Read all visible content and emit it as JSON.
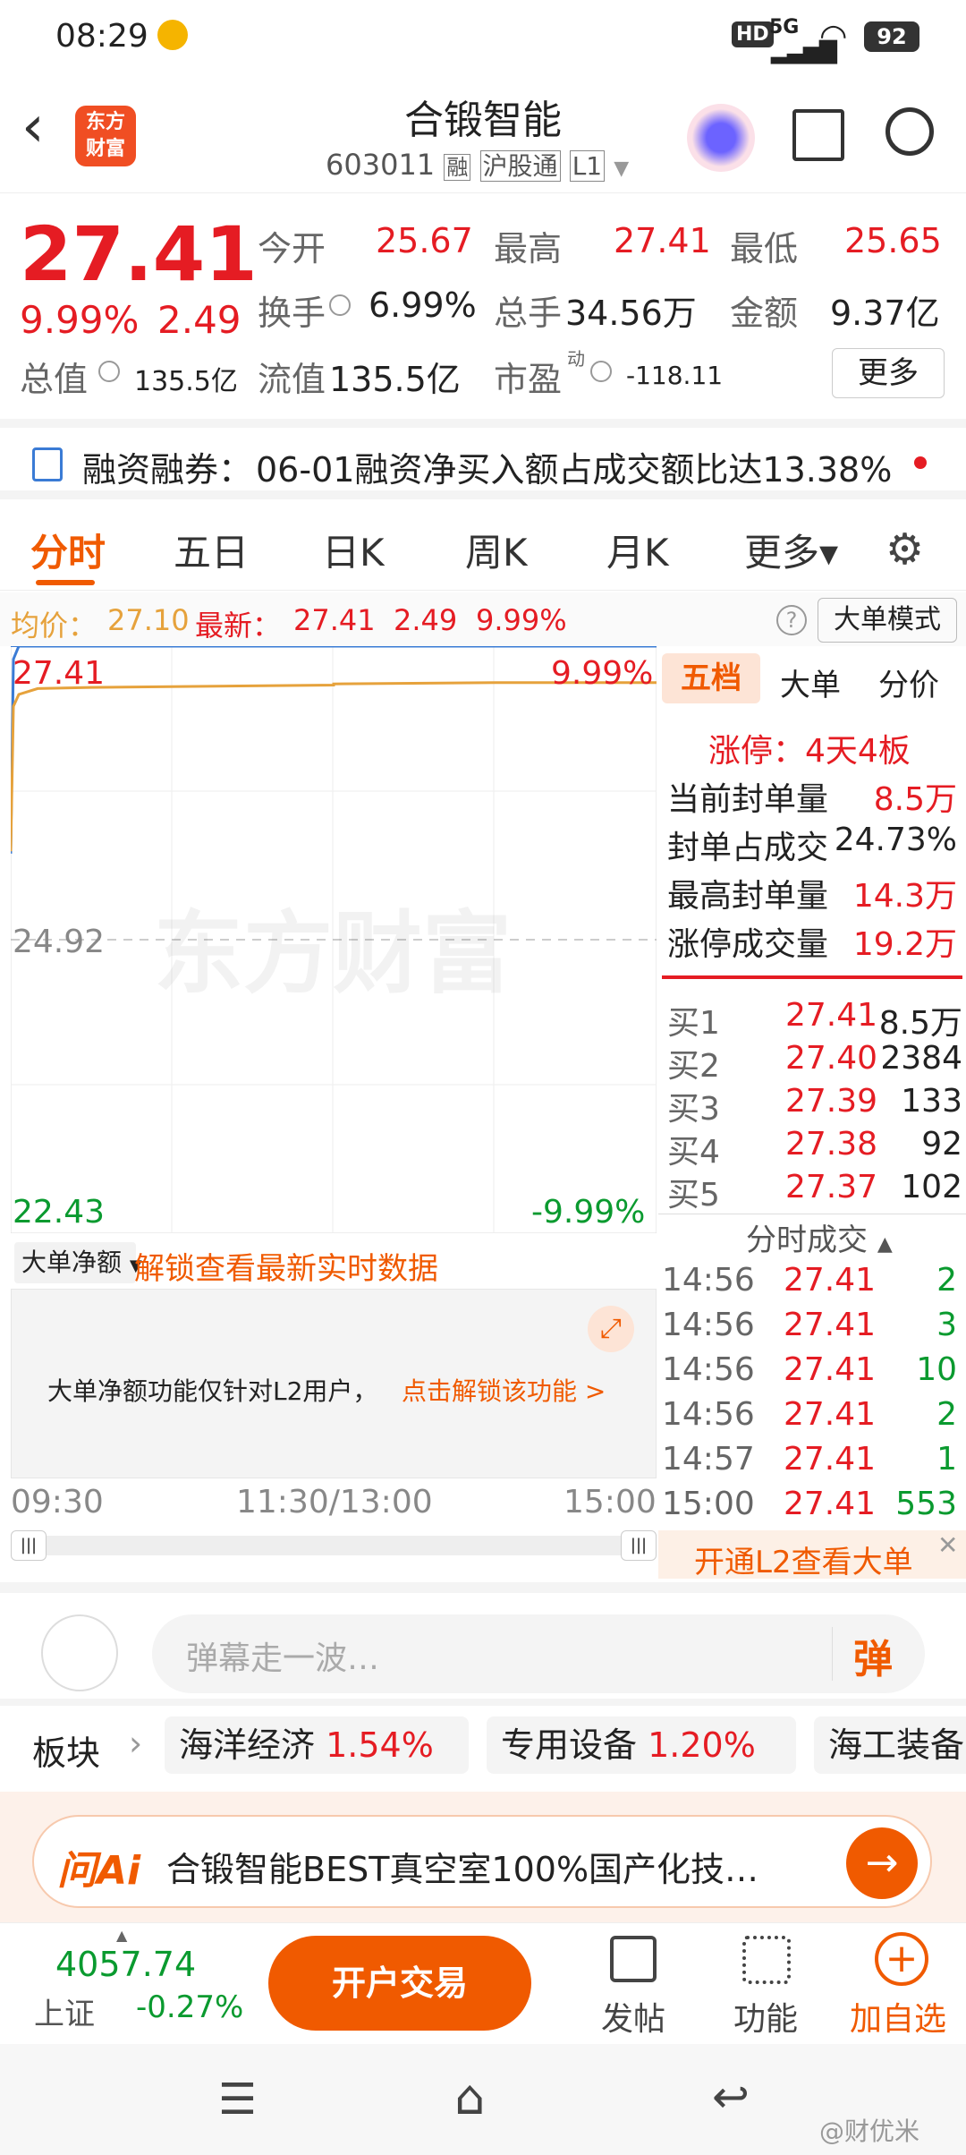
{
  "status": {
    "time": "08:29",
    "network": "5G",
    "battery": "92",
    "hd": "HD"
  },
  "header": {
    "title": "合锻智能",
    "code": "603011",
    "tags": [
      "融",
      "沪股通",
      "L1"
    ],
    "logo_line1": "东方",
    "logo_line2": "财富"
  },
  "quote": {
    "price": "27.41",
    "change_pct": "9.99%",
    "change": "2.49",
    "open_label": "今开",
    "open": "25.67",
    "high_label": "最高",
    "high": "27.41",
    "low_label": "最低",
    "low": "25.65",
    "turnover_label": "换手",
    "turnover": "6.99%",
    "volume_label": "总手",
    "volume": "34.56万",
    "amount_label": "金额",
    "amount": "9.37亿",
    "mktcap_label": "总值",
    "mktcap": "135.5亿",
    "float_label": "流值",
    "float": "135.5亿",
    "pe_label": "市盈",
    "pe_sup": "动",
    "pe": "-118.11",
    "more_btn": "更多"
  },
  "notice": {
    "label": "融资融券：",
    "text": "06-01融资净买入额占成交额比达13.38%"
  },
  "tabs": [
    "分时",
    "五日",
    "日K",
    "周K",
    "月K",
    "更多▾"
  ],
  "infoline": {
    "avg_label": "均价：",
    "avg": "27.10",
    "latest_label": "最新：",
    "latest": "27.41",
    "chg": "2.49",
    "pct": "9.99%",
    "mode_btn": "大单模式"
  },
  "chart": {
    "top_price": "27.41",
    "top_pct": "9.99%",
    "mid_price": "24.92",
    "bottom_price": "22.43",
    "bottom_pct": "-9.99%",
    "watermark": "东方财富",
    "time_labels": [
      "09:30",
      "11:30/13:00",
      "15:00"
    ]
  },
  "chart_data": {
    "type": "line",
    "x": [
      "09:30",
      "09:31",
      "09:33",
      "09:40",
      "10:00",
      "11:30",
      "13:00",
      "14:00",
      "15:00"
    ],
    "series": [
      {
        "values": [
          25.65,
          27.3,
          27.41,
          27.41,
          27.41,
          27.41,
          27.41,
          27.41,
          27.41
        ]
      },
      {
        "values": [
          25.67,
          26.9,
          27.0,
          27.05,
          27.06,
          27.08,
          27.09,
          27.1,
          27.1
        ]
      }
    ],
    "ylim": [
      22.43,
      27.41
    ],
    "colors": {
      "price": "#3a7bd5",
      "avg": "#e6a23c"
    }
  },
  "book": {
    "tabs": [
      "五档",
      "大单",
      "分价"
    ],
    "limit_up": "涨停：4天4板",
    "stats": [
      {
        "label": "当前封单量",
        "value": "8.5万"
      },
      {
        "label": "封单占成交",
        "value": "24.73%"
      },
      {
        "label": "最高封单量",
        "value": "14.3万"
      },
      {
        "label": "涨停成交量",
        "value": "19.2万"
      }
    ],
    "bids": [
      {
        "label": "买1",
        "price": "27.41",
        "vol": "8.5万"
      },
      {
        "label": "买2",
        "price": "27.40",
        "vol": "2384"
      },
      {
        "label": "买3",
        "price": "27.39",
        "vol": "133"
      },
      {
        "label": "买4",
        "price": "27.38",
        "vol": "92"
      },
      {
        "label": "买5",
        "price": "27.37",
        "vol": "102"
      }
    ],
    "trades_title": "分时成交",
    "trades": [
      {
        "time": "14:56",
        "price": "27.41",
        "vol": "2"
      },
      {
        "time": "14:56",
        "price": "27.41",
        "vol": "3"
      },
      {
        "time": "14:56",
        "price": "27.41",
        "vol": "10"
      },
      {
        "time": "14:56",
        "price": "27.41",
        "vol": "2"
      },
      {
        "time": "14:57",
        "price": "27.41",
        "vol": "1"
      },
      {
        "time": "15:00",
        "price": "27.41",
        "vol": "553"
      }
    ],
    "l2_banner": "开通L2查看大单"
  },
  "lower": {
    "selector": "大单净额",
    "unlock_link": "解锁查看最新实时数据",
    "msg": "大单净额功能仅针对L2用户，",
    "msg_link": "点击解锁该功能 >"
  },
  "comment": {
    "placeholder": "弹幕走一波…",
    "danmu_btn": "弹"
  },
  "sectors": {
    "label": "板块",
    "items": [
      {
        "name": "海洋经济",
        "pct": "1.54%"
      },
      {
        "name": "专用设备",
        "pct": "1.20%"
      },
      {
        "name": "海工装备",
        "pct": ""
      }
    ]
  },
  "ai": {
    "logo": "问Ai",
    "text": "合锻智能BEST真空室100%国产化技…"
  },
  "bottom": {
    "index_value": "4057.74",
    "index_name": "上证",
    "index_pct": "-0.27%",
    "trade_btn": "开户交易",
    "post": "发帖",
    "func": "功能",
    "add": "加自选"
  },
  "watermark_user": "@财优米"
}
